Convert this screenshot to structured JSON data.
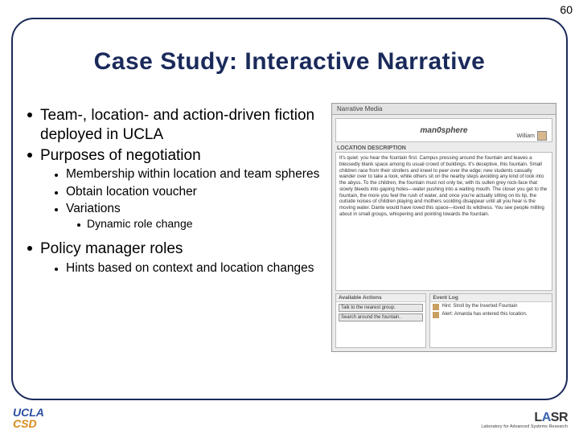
{
  "page_number": "60",
  "title": "Case Study: Interactive Narrative",
  "bullets": {
    "b1": "Team-, location- and action-driven fiction deployed in UCLA",
    "b2": "Purposes of negotiation",
    "b2_1": "Membership within location and team spheres",
    "b2_2": "Obtain location voucher",
    "b2_3": "Variations",
    "b2_3_1": "Dynamic role change",
    "b3": "Policy manager roles",
    "b3_1": "Hints based on context and location changes"
  },
  "mock": {
    "tab": "Narrative Media",
    "hero_title": "man0sphere",
    "hero_user": "William",
    "section_desc": "LOCATION DESCRIPTION",
    "desc_text": "It's quiet: you hear the fountain first. Campus pressing around the fountain and leaves a blessedly blank space among its usual crowd of buildings. It's deceptive, this fountain. Small children race from their strollers and kneel to peer over the edge; new students casually wander over to take a look, while others sit on the nearby steps avoiding any kind of look into the abyss. To the children, the fountain must not only be, with its sullen grey rock-face that slowly bleeds into gaping holes—water pushing into a waiting mouth. The closer you get to the fountain, the more you feel the rush of water, and once you're actually sitting on its lip, the outside noises of children playing and mothers scolding disappear until all you hear is the moving water. Dante would have loved this space—loved its wildness.\\nYou see people milling about in small groups, whispering and pointing towards the fountain.",
    "actions_label": "Available Actions",
    "log_label": "Event Log",
    "action1": "Talk to the nearest group.",
    "action2": "Search around the fountain.",
    "log1": "Hint: Stroll by the Inverted Fountain",
    "log2": "Alert: Amanda has entered this location."
  },
  "logos": {
    "ucla": "UCLA",
    "csd": "CSD",
    "lasr": "LASR",
    "lasr_sub": "Laboratory for Advanced Systems Research"
  }
}
